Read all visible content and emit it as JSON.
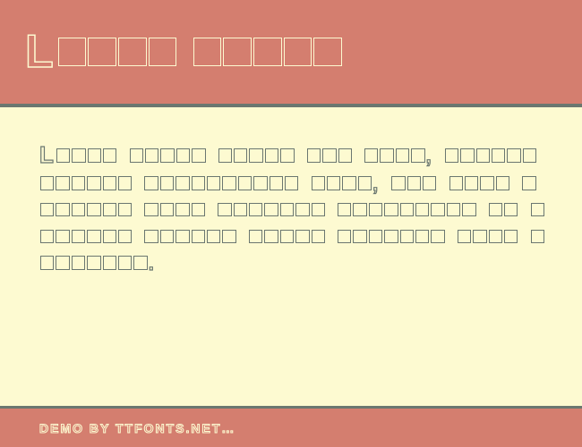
{
  "header": {
    "title_first_cap": "L",
    "title_rest": "orem ipsum"
  },
  "body": {
    "first_cap": "L",
    "text": "orem ipsum dolor sit amet, consectetuer adipiscing elit, sed diam nonummy nibh euismod tincidunt ut laoreet dolore magna aliquam erat volutpat."
  },
  "footer": {
    "text": "Demo by ttfonts.net…"
  }
}
